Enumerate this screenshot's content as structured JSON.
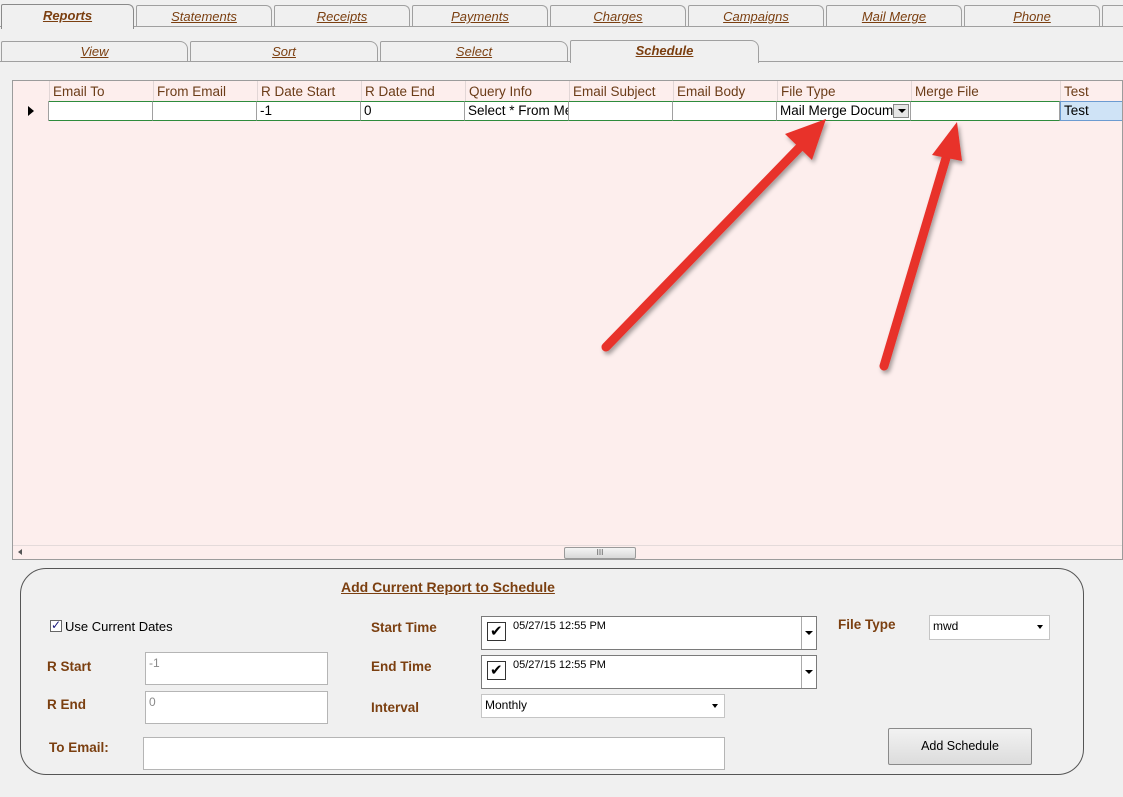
{
  "main_tabs": [
    {
      "label": "Reports",
      "active": true
    },
    {
      "label": "Statements",
      "active": false
    },
    {
      "label": "Receipts",
      "active": false
    },
    {
      "label": "Payments",
      "active": false
    },
    {
      "label": "Charges",
      "active": false
    },
    {
      "label": "Campaigns",
      "active": false
    },
    {
      "label": "Mail Merge",
      "active": false
    },
    {
      "label": "Phone",
      "active": false
    }
  ],
  "sub_tabs": [
    {
      "label": "View",
      "active": false
    },
    {
      "label": "Sort",
      "active": false
    },
    {
      "label": "Select",
      "active": false
    },
    {
      "label": "Schedule",
      "active": true
    }
  ],
  "grid": {
    "columns": [
      "Email To",
      "From Email",
      "R Date Start",
      "R Date End",
      "Query Info",
      "Email Subject",
      "Email Body",
      "File Type",
      "Merge File",
      "Test"
    ],
    "row": {
      "email_to": "",
      "from_email": "",
      "r_date_start": "-1",
      "r_date_end": "0",
      "query_info": "Select * From Me",
      "email_subject": "",
      "email_body": "",
      "file_type": "Mail Merge Docume",
      "merge_file": "",
      "test": "Test"
    },
    "scroll_thumb_glyph": "III"
  },
  "schedule_panel": {
    "title": "Add Current Report to Schedule",
    "use_current_dates_label": "Use Current Dates",
    "use_current_dates_checked": true,
    "r_start_label": "R Start",
    "r_start_value": "-1",
    "r_end_label": "R End",
    "r_end_value": "0",
    "to_email_label": "To Email:",
    "to_email_value": "",
    "start_time_label": "Start Time",
    "start_time_value": "05/27/15 12:55 PM",
    "end_time_label": "End Time",
    "end_time_value": "05/27/15 12:55 PM",
    "interval_label": "Interval",
    "interval_value": "Monthly",
    "file_type_label": "File Type",
    "file_type_value": "mwd",
    "add_button_label": "Add Schedule"
  },
  "colors": {
    "tab_text": "#7b3f10",
    "grid_bg": "#fdeeed",
    "annotation_arrow": "#e8302a"
  }
}
